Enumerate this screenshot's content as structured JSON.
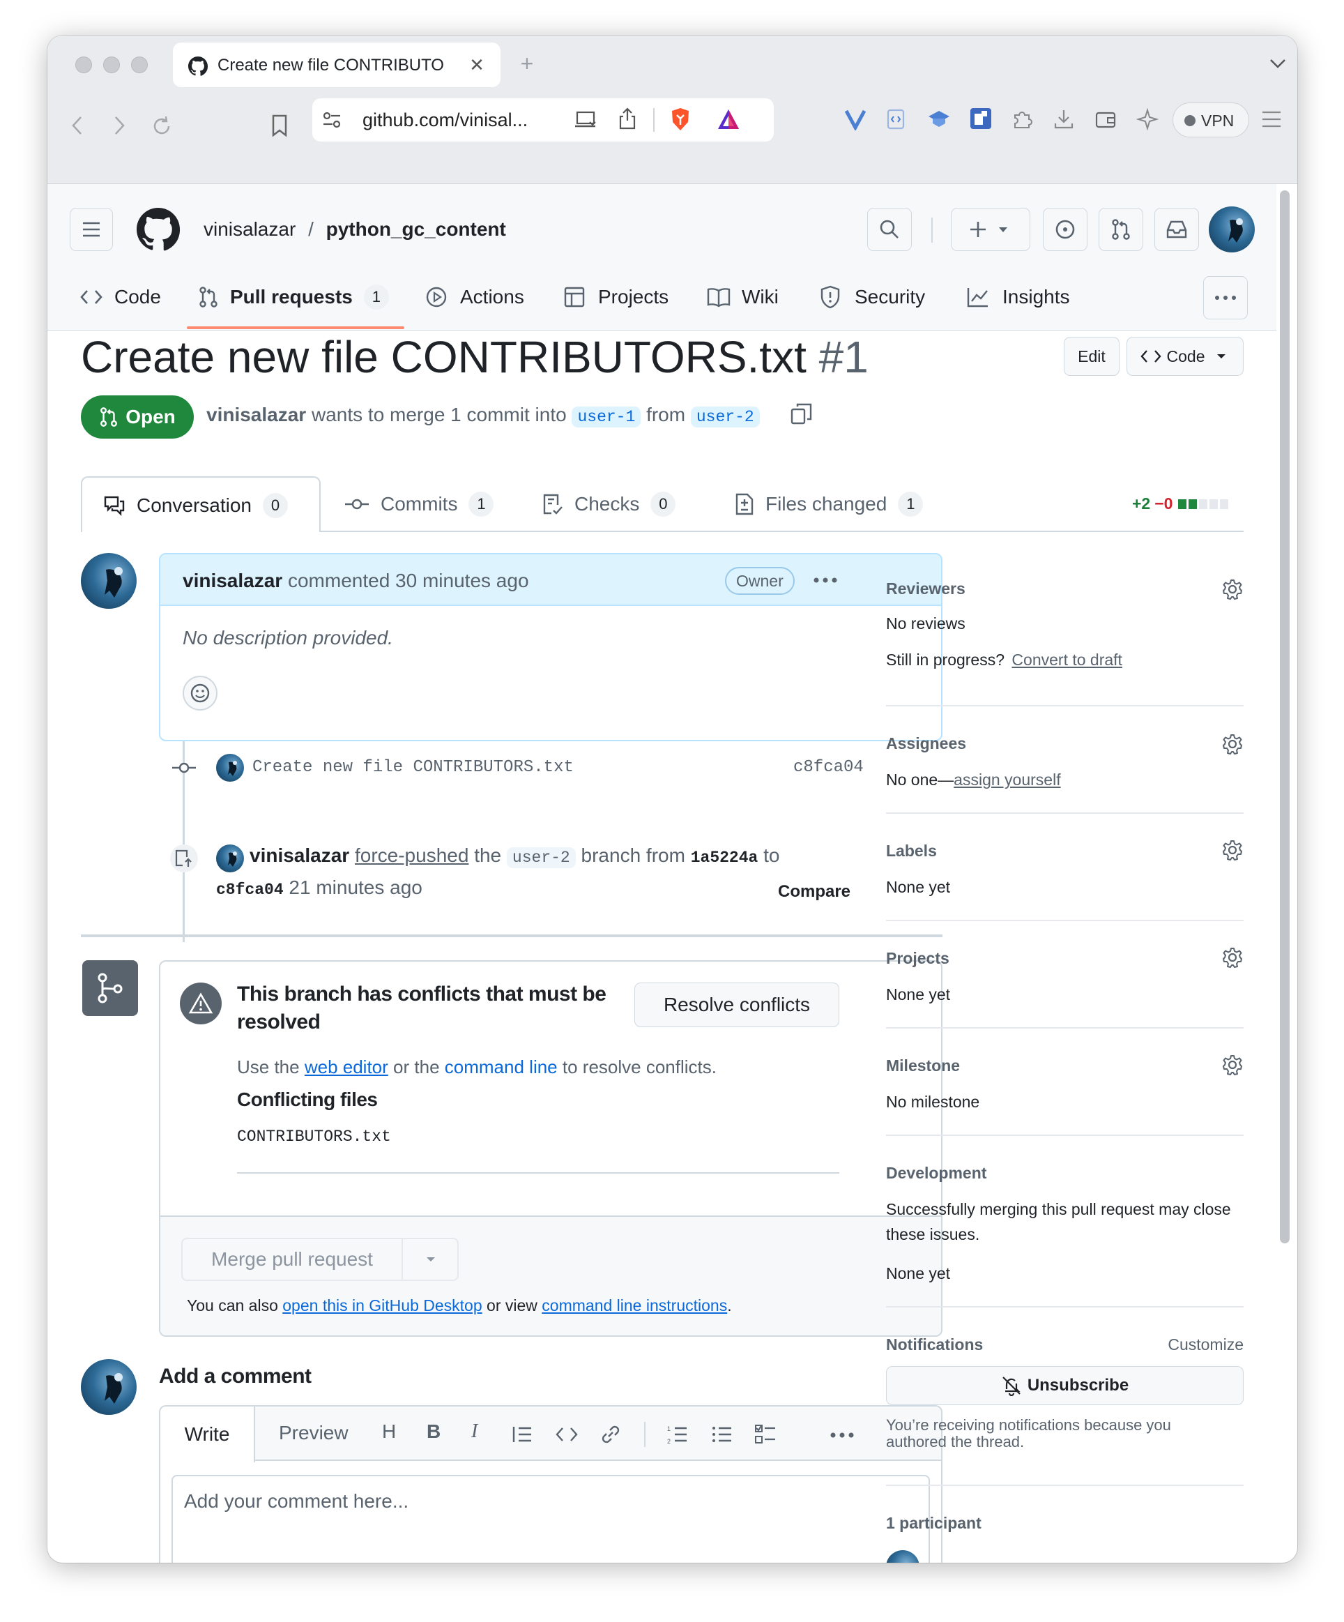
{
  "browser": {
    "tab_title": "Create new file CONTRIBUTO",
    "url": "github.com/vinisal...",
    "vpn_label": "VPN"
  },
  "repo": {
    "owner": "vinisalazar",
    "separator": "/",
    "name": "python_gc_content"
  },
  "repo_nav": [
    {
      "label": "Code",
      "icon": "code-icon"
    },
    {
      "label": "Pull requests",
      "count": "1",
      "icon": "pull-request-icon"
    },
    {
      "label": "Actions",
      "icon": "play-icon"
    },
    {
      "label": "Projects",
      "icon": "table-icon"
    },
    {
      "label": "Wiki",
      "icon": "book-icon"
    },
    {
      "label": "Security",
      "icon": "shield-icon"
    },
    {
      "label": "Insights",
      "icon": "graph-icon"
    }
  ],
  "pr": {
    "title": "Create new file CONTRIBUTORS.txt",
    "number": "#1",
    "edit_label": "Edit",
    "code_label": "Code",
    "state": "Open",
    "author": "vinisalazar",
    "merge_text_1": "wants to merge 1 commit into",
    "base_branch": "user-1",
    "merge_text_2": "from",
    "head_branch": "user-2"
  },
  "pr_tabs": [
    {
      "label": "Conversation",
      "count": "0"
    },
    {
      "label": "Commits",
      "count": "1"
    },
    {
      "label": "Checks",
      "count": "0"
    },
    {
      "label": "Files changed",
      "count": "1"
    }
  ],
  "diffstat": {
    "added": "+2",
    "removed": "−0"
  },
  "comment": {
    "author": "vinisalazar",
    "meta": "commented 30 minutes ago",
    "badge": "Owner",
    "body": "No description provided."
  },
  "commit": {
    "message": "Create new file CONTRIBUTORS.txt",
    "sha": "c8fca04"
  },
  "force_push": {
    "actor": "vinisalazar",
    "action": "force-pushed",
    "text_1": "the",
    "branch": "user-2",
    "text_2": "branch from",
    "from_sha": "1a5224a",
    "text_3": "to",
    "to_sha": "c8fca04",
    "time": "21 minutes ago",
    "compare_label": "Compare"
  },
  "conflicts": {
    "title_line1": "This branch has conflicts that must be",
    "title_line2": "resolved",
    "resolve_label": "Resolve conflicts",
    "desc_1": "Use the",
    "web_editor": "web editor",
    "desc_2": "or the",
    "command_line": "command line",
    "desc_3": "to resolve conflicts.",
    "files_heading": "Conflicting files",
    "files": [
      "CONTRIBUTORS.txt"
    ]
  },
  "merge": {
    "button_label": "Merge pull request",
    "also_1": "You can also",
    "desktop_link": "open this in GitHub Desktop",
    "also_2": "or view",
    "cli_link": "command line instructions",
    "also_3": "."
  },
  "add_comment": {
    "heading": "Add a comment",
    "write_tab": "Write",
    "preview_tab": "Preview",
    "placeholder": "Add your comment here..."
  },
  "sidebar": {
    "reviewers": {
      "heading": "Reviewers",
      "value": "No reviews",
      "draft_prompt": "Still in progress?",
      "draft_link": "Convert to draft"
    },
    "assignees": {
      "heading": "Assignees",
      "value": "No one—",
      "assign_link": "assign yourself"
    },
    "labels": {
      "heading": "Labels",
      "value": "None yet"
    },
    "projects": {
      "heading": "Projects",
      "value": "None yet"
    },
    "milestone": {
      "heading": "Milestone",
      "value": "No milestone"
    },
    "development": {
      "heading": "Development",
      "line1": "Successfully merging this pull request may close",
      "line2": "these issues.",
      "value": "None yet"
    },
    "notifications": {
      "heading": "Notifications",
      "customize": "Customize",
      "unsubscribe": "Unsubscribe",
      "reason_1": "You’re receiving notifications because you",
      "reason_2": "authored the thread."
    },
    "participants": {
      "heading": "1 participant"
    }
  },
  "colors": {
    "accent": "#0969da",
    "open_green": "#1f883d",
    "underline": "#fd8c73",
    "add_green": "#1a7f37",
    "del_red": "#d1242f"
  }
}
